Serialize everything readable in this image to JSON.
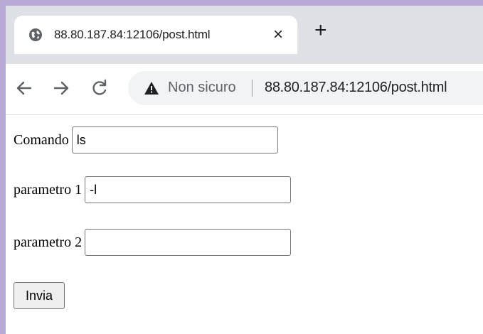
{
  "browser": {
    "tab": {
      "title": "88.80.187.84:12106/post.html",
      "close_glyph": "×",
      "favicon": "globe-icon"
    },
    "new_tab_glyph": "+",
    "omnibox": {
      "security_label": "Non sicuro",
      "url": "88.80.187.84:12106/post.html",
      "security_icon": "warning-icon"
    }
  },
  "form": {
    "comando_label": "Comando",
    "comando_value": "ls",
    "param1_label": "parametro 1",
    "param1_value": "-l",
    "param2_label": "parametro 2",
    "param2_value": "",
    "submit_label": "Invia"
  }
}
